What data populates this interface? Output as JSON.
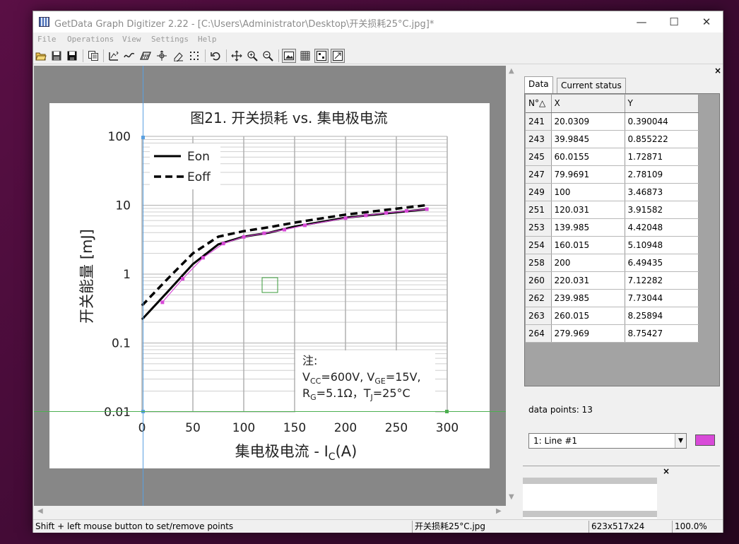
{
  "window": {
    "title": "GetData Graph Digitizer 2.22 - [C:\\Users\\Administrator\\Desktop\\开关损耗25°C.jpg]*",
    "controls": {
      "minimize": "—",
      "maximize": "☐",
      "close": "✕"
    }
  },
  "menu": [
    "File",
    "Operations",
    "View",
    "Settings",
    "Help"
  ],
  "toolbar_icons": [
    "open-icon",
    "save-icon",
    "save-all-icon",
    "copy-icon",
    "set-scale-icon",
    "auto-trace-line-icon",
    "digitize-area-icon",
    "point-capture-icon",
    "eraser-icon",
    "grid-capture-icon",
    "undo-icon",
    "pan-icon",
    "zoom-in-icon",
    "zoom-out-icon",
    "show-image-icon",
    "show-grid-icon",
    "show-points-icon",
    "fit-window-icon"
  ],
  "plot_image": {
    "title": "图21. 开关损耗 vs. 集电极电流",
    "ylabel": "开关能量 [mJ]",
    "xlabel_main": "集电极电流 - I",
    "xlabel_sub": "C",
    "xlabel_end": "(A)",
    "xticks": [
      "0",
      "50",
      "100",
      "150",
      "200",
      "250",
      "300"
    ],
    "yticks": [
      "100",
      "10",
      "1",
      "0.1",
      "0.01"
    ],
    "legend": [
      "Eon",
      "Eoff"
    ],
    "note": {
      "title": "注:",
      "line1": {
        "a": "V",
        "a_sub": "CC",
        "b": "=600V, V",
        "b_sub": "GE",
        "c": "=15V,"
      },
      "line2": {
        "a": "R",
        "a_sub": "G",
        "b": "=5.1Ω，T",
        "b_sub": "J",
        "c": "=25°C"
      }
    },
    "eon_curve": [
      [
        0,
        0.22
      ],
      [
        25,
        0.55
      ],
      [
        50,
        1.4
      ],
      [
        75,
        2.7
      ],
      [
        100,
        3.5
      ],
      [
        125,
        4.0
      ],
      [
        150,
        4.9
      ],
      [
        200,
        6.6
      ],
      [
        250,
        7.9
      ],
      [
        279,
        8.7
      ]
    ],
    "eoff_curve": [
      [
        0,
        0.35
      ],
      [
        25,
        0.85
      ],
      [
        50,
        2.0
      ],
      [
        75,
        3.5
      ],
      [
        100,
        4.2
      ],
      [
        125,
        4.8
      ],
      [
        150,
        5.6
      ],
      [
        200,
        7.3
      ],
      [
        250,
        8.9
      ],
      [
        279,
        10.0
      ]
    ]
  },
  "axis_color": "#5aa0e0",
  "scale_line_color": "#4caf50",
  "point_color": "#d84ad8",
  "panel": {
    "tabs": [
      "Data",
      "Current status"
    ],
    "table": {
      "headers": [
        "N°△",
        "X",
        "Y"
      ],
      "rows": [
        [
          "241",
          "20.0309",
          "0.390044"
        ],
        [
          "243",
          "39.9845",
          "0.855222"
        ],
        [
          "245",
          "60.0155",
          "1.72871"
        ],
        [
          "247",
          "79.9691",
          "2.78109"
        ],
        [
          "249",
          "100",
          "3.46873"
        ],
        [
          "251",
          "120.031",
          "3.91582"
        ],
        [
          "253",
          "139.985",
          "4.42048"
        ],
        [
          "254",
          "160.015",
          "5.10948"
        ],
        [
          "258",
          "200",
          "6.49435"
        ],
        [
          "260",
          "220.031",
          "7.12282"
        ],
        [
          "262",
          "239.985",
          "7.73044"
        ],
        [
          "263",
          "260.015",
          "8.25894"
        ],
        [
          "264",
          "279.969",
          "8.75427"
        ]
      ]
    },
    "data_points_label": "data points: 13",
    "line_select": "1: Line #1",
    "close_glyph": "×"
  },
  "status": {
    "hint": "Shift + left mouse button to set/remove points",
    "file": "开关损耗25°C.jpg",
    "dims": "623x517x24",
    "zoom": "100.0%"
  }
}
